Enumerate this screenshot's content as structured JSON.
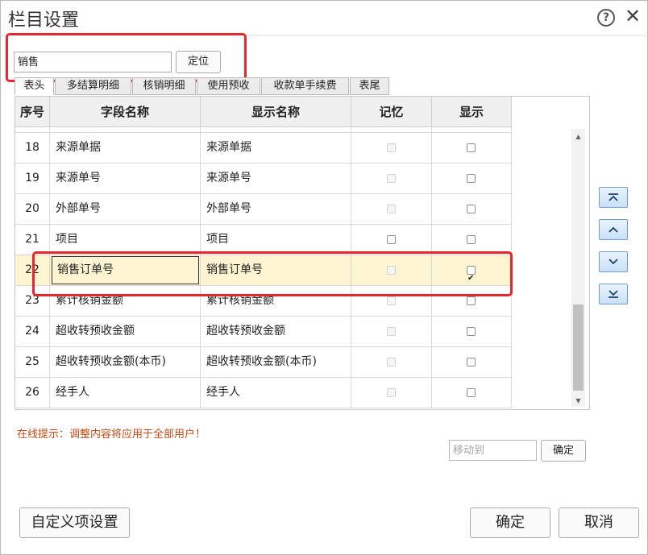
{
  "window": {
    "title": "栏目设置"
  },
  "search": {
    "value": "销售",
    "locate_label": "定位"
  },
  "tabs": [
    {
      "label": "表头",
      "active": true
    },
    {
      "label": "多结算明细",
      "active": false
    },
    {
      "label": "核销明细",
      "active": false
    },
    {
      "label": "使用预收",
      "active": false
    },
    {
      "label": "收款单手续费",
      "active": false
    },
    {
      "label": "表尾",
      "active": false
    }
  ],
  "table": {
    "columns": [
      "序号",
      "字段名称",
      "显示名称",
      "记忆",
      "显示"
    ],
    "rows": [
      {
        "no": "18",
        "field": "来源单据",
        "display": "来源单据",
        "memory_enabled": false,
        "memory": false,
        "show": false,
        "selected": false
      },
      {
        "no": "19",
        "field": "来源单号",
        "display": "来源单号",
        "memory_enabled": false,
        "memory": false,
        "show": false,
        "selected": false
      },
      {
        "no": "20",
        "field": "外部单号",
        "display": "外部单号",
        "memory_enabled": false,
        "memory": false,
        "show": false,
        "selected": false
      },
      {
        "no": "21",
        "field": "项目",
        "display": "项目",
        "memory_enabled": true,
        "memory": false,
        "show": false,
        "selected": false
      },
      {
        "no": "22",
        "field": "销售订单号",
        "display": "销售订单号",
        "memory_enabled": false,
        "memory": false,
        "show": true,
        "selected": true
      },
      {
        "no": "23",
        "field": "累计核销金额",
        "display": "累计核销金额",
        "memory_enabled": false,
        "memory": false,
        "show": false,
        "selected": false
      },
      {
        "no": "24",
        "field": "超收转预收金额",
        "display": "超收转预收金额",
        "memory_enabled": false,
        "memory": false,
        "show": false,
        "selected": false
      },
      {
        "no": "25",
        "field": "超收转预收金额(本币)",
        "display": "超收转预收金额(本币)",
        "memory_enabled": false,
        "memory": false,
        "show": false,
        "selected": false
      },
      {
        "no": "26",
        "field": "经手人",
        "display": "经手人",
        "memory_enabled": false,
        "memory": false,
        "show": false,
        "selected": false
      }
    ]
  },
  "hint": "在线提示：调整内容将应用于全部用户！",
  "move_to": {
    "placeholder": "移动到",
    "confirm_label": "确定"
  },
  "footer": {
    "custom_label": "自定义项设置",
    "ok_label": "确定",
    "cancel_label": "取消"
  },
  "colors": {
    "highlight": "#e8262b",
    "selected_row": "#fdf4d2",
    "hint": "#c74a12"
  }
}
